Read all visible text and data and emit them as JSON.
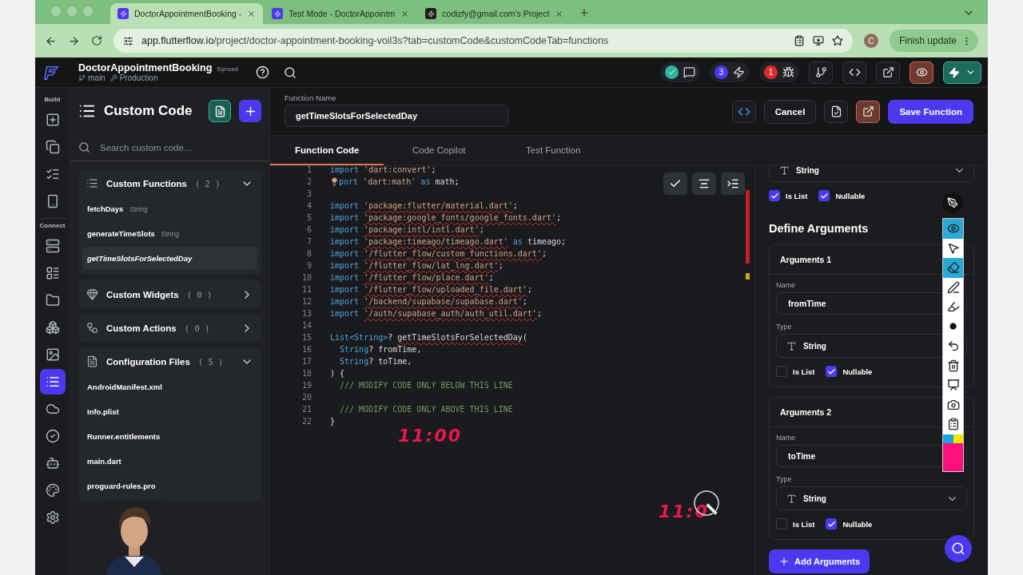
{
  "browser": {
    "tabs": [
      {
        "title": "DoctorAppointmentBooking -",
        "selected": true
      },
      {
        "title": "Test Mode - DoctorAppointm",
        "selected": false
      },
      {
        "title": "codizfy@gmail.com's Project",
        "selected": false
      }
    ],
    "url_host": "app.flutterflow.io",
    "url_path": "/project/doctor-appointment-booking-voil3s?tab=customCode&customCodeTab=functions",
    "profile_initial": "C",
    "update_button": "Finish update"
  },
  "app_header": {
    "project": "DoctorAppointmentBooking",
    "sync_status": "Synced",
    "branch": "main",
    "environment": "Production",
    "checks_passed": true,
    "badges": [
      {
        "count": "3",
        "color": "#4b39ef"
      },
      {
        "count": "1",
        "color": "#e0282e"
      }
    ]
  },
  "rail": {
    "groups": [
      {
        "label": "Build",
        "items": [
          {
            "selected": false
          },
          {
            "selected": false
          },
          {
            "selected": false
          },
          {
            "selected": false
          }
        ]
      },
      {
        "label": "Connect",
        "items": [
          {
            "selected": false
          },
          {
            "selected": false
          },
          {
            "selected": false
          },
          {
            "selected": false
          },
          {
            "selected": false
          },
          {
            "selected": true
          },
          {
            "selected": false
          },
          {
            "selected": false
          },
          {
            "selected": false
          },
          {
            "selected": false
          },
          {
            "selected": false
          }
        ]
      }
    ]
  },
  "panel": {
    "title": "Custom Code",
    "search_placeholder": "Search custom code...",
    "sections": [
      {
        "kind": "functions",
        "title": "Custom Functions",
        "count": "( 2 )",
        "expanded": true,
        "items": [
          {
            "name": "fetchDays",
            "type": "String",
            "selected": false
          },
          {
            "name": "generateTimeSlots",
            "type": "String",
            "selected": false
          },
          {
            "name": "getTimeSlotsForSelectedDay",
            "selected": true
          }
        ]
      },
      {
        "kind": "widgets",
        "title": "Custom Widgets",
        "count": "( 0 )",
        "expanded": false
      },
      {
        "kind": "actions",
        "title": "Custom Actions",
        "count": "( 0 )",
        "expanded": false
      },
      {
        "kind": "files",
        "title": "Configuration Files",
        "count": "( 5 )",
        "expanded": true,
        "items": [
          {
            "name": "AndroidManifest.xml",
            "selected": false
          },
          {
            "name": "Info.plist",
            "selected": false
          },
          {
            "name": "Runner.entitlements",
            "selected": false
          },
          {
            "name": "main.dart",
            "selected": false
          },
          {
            "name": "proguard-rules.pro",
            "selected": false
          }
        ]
      }
    ]
  },
  "editor": {
    "function_name_label": "Function Name",
    "function_name": "getTimeSlotsForSelectedDay",
    "tabs": [
      {
        "label": "Function Code",
        "selected": true
      },
      {
        "label": "Code Copilot",
        "selected": false
      },
      {
        "label": "Test Function",
        "selected": false
      }
    ],
    "lines": [
      {
        "n": "1",
        "tokens": [
          {
            "t": "import ",
            "kind": "keyword"
          },
          {
            "t": "'dart:convert'",
            "kind": "string"
          },
          {
            "t": ";",
            "kind": "plain"
          }
        ]
      },
      {
        "n": "2",
        "tokens": [
          {
            "kind": "bulb"
          },
          {
            "t": "port ",
            "kind": "keyword"
          },
          {
            "t": "'dart:math'",
            "kind": "string"
          },
          {
            "t": " as ",
            "kind": "keyword"
          },
          {
            "t": "math;",
            "kind": "plain"
          }
        ]
      },
      {
        "n": "3"
      },
      {
        "n": "4",
        "tokens": [
          {
            "t": "import ",
            "kind": "keyword"
          },
          {
            "t": "'package:flutter/material.dart'",
            "kind": "string",
            "error": true
          },
          {
            "t": ";",
            "kind": "plain"
          }
        ]
      },
      {
        "n": "5",
        "tokens": [
          {
            "t": "import ",
            "kind": "keyword"
          },
          {
            "t": "'package:google_fonts/google_fonts.dart'",
            "kind": "string",
            "error": true
          },
          {
            "t": ";",
            "kind": "plain"
          }
        ]
      },
      {
        "n": "6",
        "tokens": [
          {
            "t": "import ",
            "kind": "keyword"
          },
          {
            "t": "'package:intl/intl.dart'",
            "kind": "string",
            "error": true
          },
          {
            "t": ";",
            "kind": "plain"
          }
        ]
      },
      {
        "n": "7",
        "tokens": [
          {
            "t": "import ",
            "kind": "keyword"
          },
          {
            "t": "'package:timeago/timeago.dart'",
            "kind": "string",
            "error": true
          },
          {
            "t": " as ",
            "kind": "keyword"
          },
          {
            "t": "timeago;",
            "kind": "plain"
          }
        ]
      },
      {
        "n": "8",
        "tokens": [
          {
            "t": "import ",
            "kind": "keyword"
          },
          {
            "t": "'/flutter_flow/custom_functions.dart'",
            "kind": "string",
            "error": true
          },
          {
            "t": ";",
            "kind": "plain"
          }
        ]
      },
      {
        "n": "9",
        "tokens": [
          {
            "t": "import ",
            "kind": "keyword"
          },
          {
            "t": "'/flutter_flow/lat_lng.dart'",
            "kind": "string",
            "error": true
          },
          {
            "t": ";",
            "kind": "plain"
          }
        ]
      },
      {
        "n": "10",
        "tokens": [
          {
            "t": "import ",
            "kind": "keyword"
          },
          {
            "t": "'/flutter_flow/place.dart'",
            "kind": "string",
            "error": true
          },
          {
            "t": ";",
            "kind": "plain"
          }
        ]
      },
      {
        "n": "11",
        "tokens": [
          {
            "t": "import ",
            "kind": "keyword"
          },
          {
            "t": "'/flutter_flow/uploaded_file.dart'",
            "kind": "string",
            "error": true
          },
          {
            "t": ";",
            "kind": "plain"
          }
        ]
      },
      {
        "n": "12",
        "tokens": [
          {
            "t": "import ",
            "kind": "keyword"
          },
          {
            "t": "'/backend/supabase/supabase.dart'",
            "kind": "string",
            "error": true
          },
          {
            "t": ";",
            "kind": "plain"
          }
        ]
      },
      {
        "n": "13",
        "tokens": [
          {
            "t": "import ",
            "kind": "keyword"
          },
          {
            "t": "'/auth/supabase_auth/auth_util.dart'",
            "kind": "string",
            "error": true
          },
          {
            "t": ";",
            "kind": "plain"
          }
        ]
      },
      {
        "n": "14"
      },
      {
        "n": "15",
        "tokens": [
          {
            "t": "List<String>",
            "kind": "keyword"
          },
          {
            "t": "? ",
            "kind": "plain"
          },
          {
            "t": "getTimeSlotsForSelectedDay",
            "kind": "plain",
            "error": true
          },
          {
            "t": "(",
            "kind": "plain"
          }
        ]
      },
      {
        "n": "16",
        "tokens": [
          {
            "t": "  String",
            "kind": "keyword"
          },
          {
            "t": "? fromTime,",
            "kind": "plain"
          }
        ]
      },
      {
        "n": "17",
        "tokens": [
          {
            "t": "  String",
            "kind": "keyword"
          },
          {
            "t": "? toTime,",
            "kind": "plain"
          }
        ]
      },
      {
        "n": "18",
        "tokens": [
          {
            "t": ") {",
            "kind": "plain"
          }
        ]
      },
      {
        "n": "19",
        "tokens": [
          {
            "t": "  /// MODIFY CODE ONLY BELOW THIS LINE",
            "kind": "comment"
          }
        ]
      },
      {
        "n": "20"
      },
      {
        "n": "21",
        "tokens": [
          {
            "t": "  /// MODIFY CODE ONLY ABOVE THIS LINE",
            "kind": "comment"
          }
        ]
      },
      {
        "n": "22",
        "tokens": [
          {
            "t": "}",
            "kind": "plain"
          }
        ]
      }
    ],
    "annotations": [
      "11:00",
      "11:0"
    ]
  },
  "actions": {
    "cancel": "Cancel",
    "save": "Save Function"
  },
  "arguments": {
    "top_type": "String",
    "top_is_list": true,
    "top_is_list_label": "Is List",
    "top_nullable": true,
    "top_nullable_label": "Nullable",
    "heading": "Define Arguments",
    "items": [
      {
        "title": "Arguments 1",
        "name_label": "Name",
        "name": "fromTime",
        "type_label": "Type",
        "type": "String",
        "is_list": false,
        "is_list_label": "Is List",
        "nullable": true,
        "nullable_label": "Nullable"
      },
      {
        "title": "Arguments 2",
        "name_label": "Name",
        "name": "toTime",
        "type_label": "Type",
        "type": "String",
        "is_list": false,
        "is_list_label": "Is List",
        "nullable": true,
        "nullable_label": "Nullable"
      }
    ],
    "add_button": "Add Arguments"
  }
}
